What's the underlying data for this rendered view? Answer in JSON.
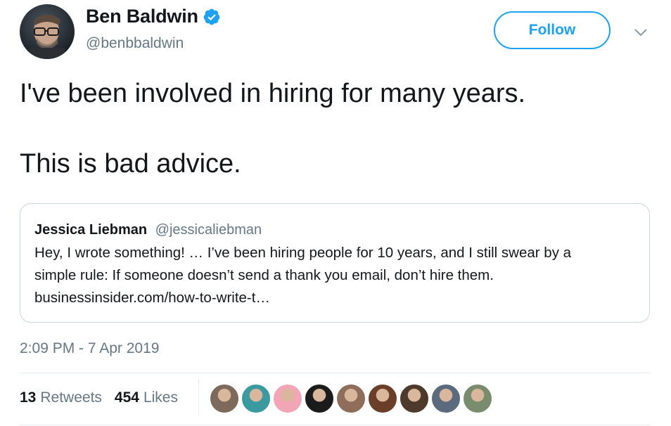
{
  "author": {
    "name": "Ben Baldwin",
    "handle": "@benbbaldwin",
    "verified": true,
    "avatar_icon": "profile-photo-icon"
  },
  "follow_button": {
    "label": "Follow"
  },
  "menu_icon": "chevron-down-icon",
  "tweet": {
    "paragraphs": [
      "I've been involved in hiring for many years.",
      "This is bad advice."
    ]
  },
  "quoted_tweet": {
    "name": "Jessica Liebman",
    "handle": "@jessicaliebman",
    "lines": [
      "Hey, I wrote something! … I’ve been hiring people for 10 years, and I still swear by a",
      "simple rule: If someone doesn’t send a thank you email, don’t hire them.",
      "businessinsider.com/how-to-write-t…"
    ]
  },
  "timestamp": "2:09 PM - 7 Apr 2019",
  "stats": {
    "retweets_count": "13",
    "retweets_label": "Retweets",
    "likes_count": "454",
    "likes_label": "Likes"
  },
  "likers": [
    {
      "icon": "liker-avatar-1",
      "color": "#7d6a5a"
    },
    {
      "icon": "liker-avatar-2",
      "color": "#3a9aa0"
    },
    {
      "icon": "liker-avatar-3",
      "color": "#f2a5b4"
    },
    {
      "icon": "liker-avatar-4",
      "color": "#1b1b1b"
    },
    {
      "icon": "liker-avatar-5",
      "color": "#8e6d5a"
    },
    {
      "icon": "liker-avatar-6",
      "color": "#6b3e2a"
    },
    {
      "icon": "liker-avatar-7",
      "color": "#4d3a2c"
    },
    {
      "icon": "liker-avatar-8",
      "color": "#5b6a7c"
    },
    {
      "icon": "liker-avatar-9",
      "color": "#7a8c6e"
    }
  ],
  "colors": {
    "accent": "#1da1f2",
    "text_primary": "#14171a",
    "text_secondary": "#657786",
    "border": "#ccd6dd"
  }
}
